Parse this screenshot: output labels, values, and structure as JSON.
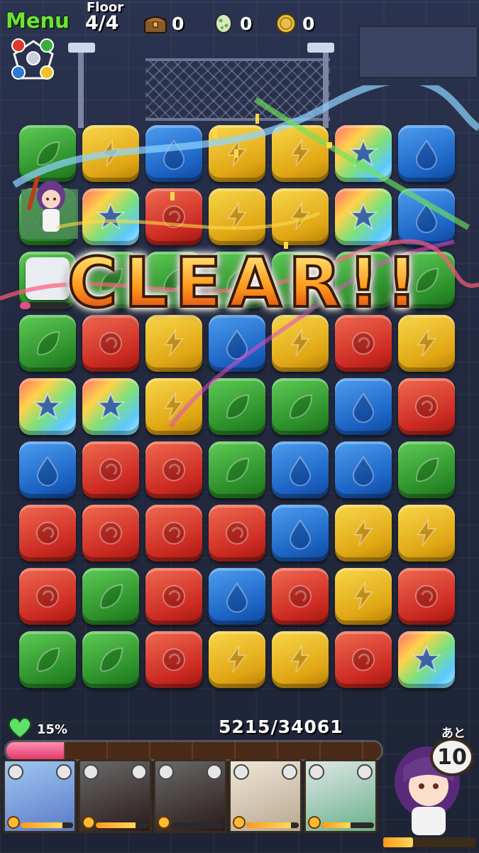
{
  "header": {
    "menu_label": "Menu",
    "floor_label": "Floor",
    "floor_value": "4/4",
    "treasure_count": "0",
    "egg_count": "0",
    "coin_count": "0",
    "icons": [
      "treasure-chest-icon",
      "egg-icon",
      "coin-icon",
      "attribute-wheel-icon"
    ]
  },
  "banner": {
    "text": "CLEAR!!"
  },
  "board": {
    "rows": 9,
    "cols": 7,
    "orbs": [
      [
        "green",
        "yellow",
        "blue",
        "yellow",
        "yellow",
        "rainbow",
        "blue"
      ],
      [
        "green",
        "rainbow",
        "red",
        "yellow",
        "yellow",
        "rainbow",
        "blue"
      ],
      [
        "green",
        "green",
        "green",
        "green",
        "green",
        "green",
        "green"
      ],
      [
        "green",
        "red",
        "yellow",
        "blue",
        "yellow",
        "red",
        "yellow"
      ],
      [
        "rainbow",
        "rainbow",
        "yellow",
        "green",
        "green",
        "blue",
        "red"
      ],
      [
        "blue",
        "red",
        "red",
        "green",
        "blue",
        "blue",
        "green"
      ],
      [
        "red",
        "red",
        "red",
        "red",
        "blue",
        "yellow",
        "yellow"
      ],
      [
        "red",
        "green",
        "red",
        "blue",
        "red",
        "yellow",
        "red"
      ],
      [
        "green",
        "green",
        "red",
        "yellow",
        "yellow",
        "red",
        "rainbow"
      ]
    ],
    "colors": {
      "green": "#3aa83a",
      "yellow": "#e8b41e",
      "blue": "#2570d6",
      "red": "#d63428",
      "rainbow": "#ff8c5a"
    }
  },
  "hud": {
    "hp_percent": "15%",
    "hp_text": "5215/34061",
    "hp_current": 5215,
    "hp_max": 34061,
    "remaining_label": "あと",
    "remaining_value": "10",
    "team": [
      {
        "name": "card-1",
        "attribute": "blue",
        "skill_gauge": 0.8
      },
      {
        "name": "card-2",
        "attribute": "red",
        "skill_gauge": 0.75
      },
      {
        "name": "card-3",
        "attribute": "red",
        "skill_gauge": 0.0
      },
      {
        "name": "card-4",
        "attribute": "yellow",
        "skill_gauge": 0.85
      },
      {
        "name": "card-5",
        "attribute": "green",
        "skill_gauge": 0.55
      }
    ],
    "leader_skill_gauge": 0.32
  }
}
